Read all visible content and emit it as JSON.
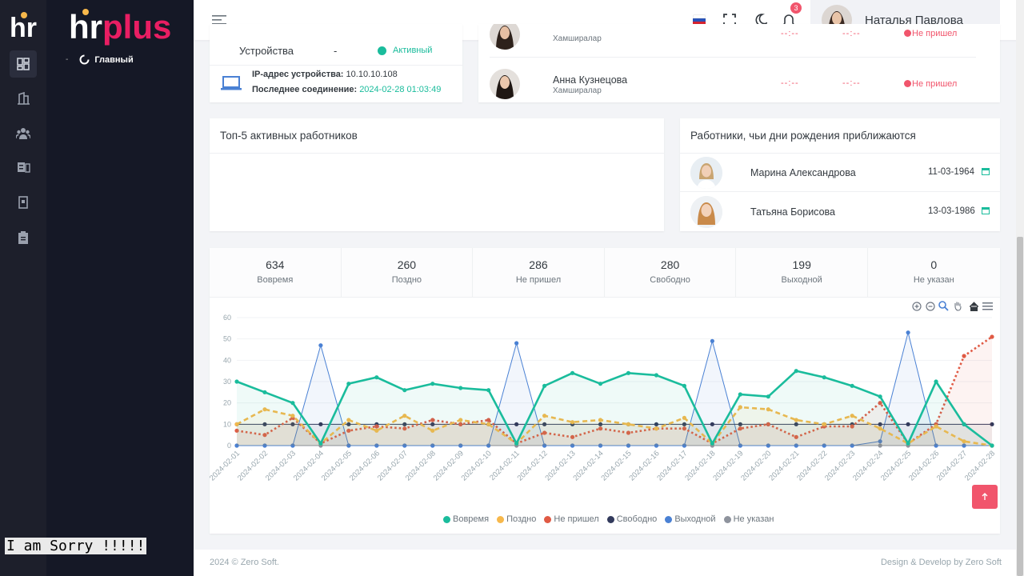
{
  "brand": {
    "name": "hrplus",
    "mini": "hr"
  },
  "menu": {
    "item_label": "Главный",
    "item_prefix": "-"
  },
  "overlay_text": "I am Sorry !!!!!",
  "topbar": {
    "notifications_count": "3",
    "user_name": "Наталья Павлова"
  },
  "device": {
    "label": "Устройства",
    "dash": "-",
    "status": "Активный",
    "ip_label": "IP-адрес устройства:",
    "ip_value": "10.10.10.108",
    "last_label": "Последнее соединение:",
    "last_value": "2024-02-28 01:03:49"
  },
  "attendance": {
    "rows": [
      {
        "name": "",
        "role": "Хамширалар",
        "time_in": "--:--",
        "time_out": "--:--",
        "status": "Не пришел"
      },
      {
        "name": "Анна Кузнецова",
        "role": "Хамширалар",
        "time_in": "--:--",
        "time_out": "--:--",
        "status": "Не пришел"
      }
    ]
  },
  "top5": {
    "title": "Топ-5 активных работников"
  },
  "birthdays": {
    "title": "Работники, чьи дни рождения приближаются",
    "rows": [
      {
        "name": "Марина Александрова",
        "date": "11-03-1964"
      },
      {
        "name": "Татьяна Борисова",
        "date": "13-03-1986"
      }
    ]
  },
  "stats": [
    {
      "value": "634",
      "label": "Вовремя"
    },
    {
      "value": "260",
      "label": "Поздно"
    },
    {
      "value": "286",
      "label": "Не пришел"
    },
    {
      "value": "280",
      "label": "Свободно"
    },
    {
      "value": "199",
      "label": "Выходной"
    },
    {
      "value": "0",
      "label": "Не указан"
    }
  ],
  "footer": {
    "left": "2024 © Zero Soft.",
    "right": "Design & Develop by Zero Soft"
  },
  "chart_data": {
    "type": "line",
    "x": [
      "2024-02-01",
      "2024-02-02",
      "2024-02-03",
      "2024-02-04",
      "2024-02-05",
      "2024-02-06",
      "2024-02-07",
      "2024-02-08",
      "2024-02-09",
      "2024-02-10",
      "2024-02-11",
      "2024-02-12",
      "2024-02-13",
      "2024-02-14",
      "2024-02-15",
      "2024-02-16",
      "2024-02-17",
      "2024-02-18",
      "2024-02-19",
      "2024-02-20",
      "2024-02-21",
      "2024-02-22",
      "2024-02-23",
      "2024-02-24",
      "2024-02-25",
      "2024-02-26",
      "2024-02-27",
      "2024-02-28"
    ],
    "ylim": [
      0,
      60
    ],
    "yticks": [
      0,
      10,
      20,
      30,
      40,
      50,
      60
    ],
    "legend_position": "bottom",
    "series": [
      {
        "name": "Вовремя",
        "color": "#1abc9c",
        "style": "solid",
        "values": [
          30,
          25,
          20,
          1,
          29,
          32,
          26,
          29,
          27,
          26,
          1,
          28,
          34,
          29,
          34,
          33,
          28,
          1,
          24,
          23,
          35,
          32,
          28,
          23,
          1,
          30,
          10,
          0
        ]
      },
      {
        "name": "Поздно",
        "color": "#f7b84b",
        "style": "dashed",
        "values": [
          10,
          17,
          14,
          1,
          12,
          7,
          14,
          7,
          12,
          10,
          1,
          14,
          11,
          12,
          10,
          8,
          13,
          1,
          18,
          17,
          12,
          10,
          14,
          8,
          1,
          9,
          2,
          0
        ]
      },
      {
        "name": "Не пришел",
        "color": "#e05a44",
        "style": "dotted",
        "values": [
          7,
          5,
          13,
          1,
          7,
          9,
          8,
          12,
          10,
          12,
          1,
          6,
          4,
          8,
          6,
          8,
          8,
          1,
          8,
          10,
          4,
          9,
          9,
          20,
          1,
          10,
          42,
          51
        ]
      },
      {
        "name": "Свободно",
        "color": "#323a5c",
        "style": "solid",
        "values": [
          10,
          10,
          10,
          10,
          10,
          10,
          10,
          10,
          10,
          10,
          10,
          10,
          10,
          10,
          10,
          10,
          10,
          10,
          10,
          10,
          10,
          10,
          10,
          10,
          10,
          10,
          10,
          10
        ]
      },
      {
        "name": "Выходной",
        "color": "#4a81d4",
        "style": "solid",
        "values": [
          0,
          0,
          0,
          47,
          0,
          0,
          0,
          0,
          0,
          0,
          48,
          0,
          0,
          0,
          0,
          0,
          0,
          49,
          0,
          0,
          0,
          0,
          0,
          2,
          53,
          0,
          0,
          0
        ]
      },
      {
        "name": "Не указан",
        "color": "#8e939d",
        "style": "solid",
        "values": [
          0,
          0,
          0,
          0,
          0,
          0,
          0,
          0,
          0,
          0,
          0,
          0,
          0,
          0,
          0,
          0,
          0,
          0,
          0,
          0,
          0,
          0,
          0,
          0,
          0,
          0,
          0,
          0
        ]
      }
    ]
  },
  "icons": [
    "dashboard-icon",
    "building-icon",
    "users-icon",
    "id-card-icon",
    "document-icon",
    "clipboard-icon",
    "menu-icon",
    "fullscreen-icon",
    "moon-icon",
    "bell-icon",
    "laptop-icon",
    "calendar-icon",
    "arrow-up-icon",
    "zoom-in-icon",
    "zoom-out-icon",
    "zoom-icon",
    "pan-icon",
    "home-icon",
    "chart-menu-icon"
  ]
}
